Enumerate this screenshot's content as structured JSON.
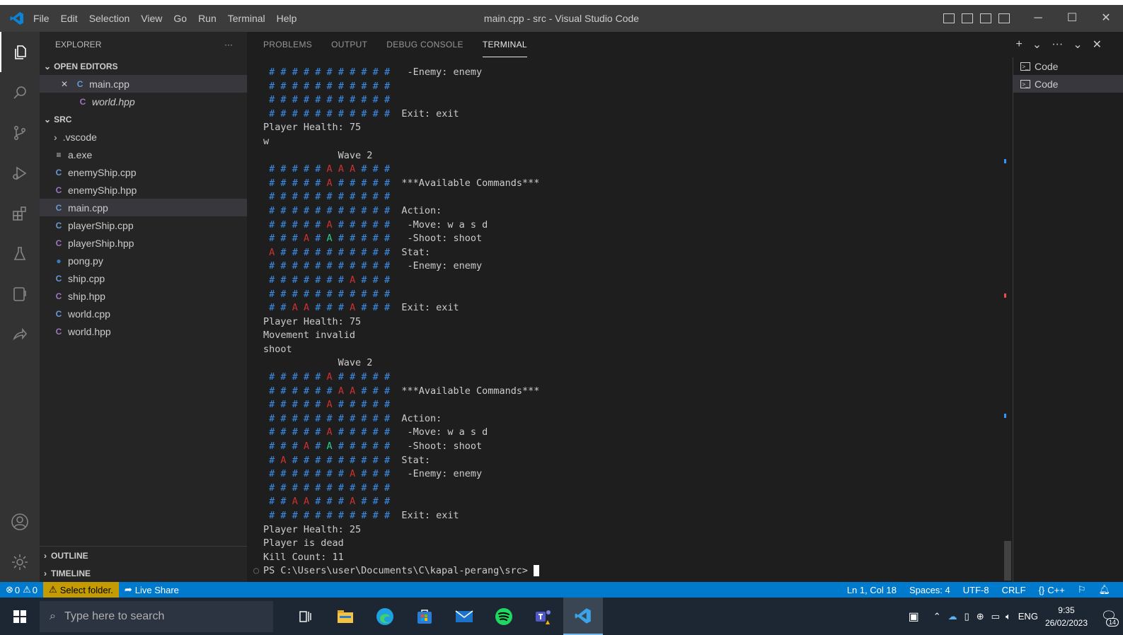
{
  "window": {
    "title": "main.cpp - src - Visual Studio Code",
    "menu": [
      "File",
      "Edit",
      "Selection",
      "View",
      "Go",
      "Run",
      "Terminal",
      "Help"
    ],
    "controls": {
      "minimize": "─",
      "maximize": "☐",
      "close": "✕"
    }
  },
  "activity_bar": [
    "explorer-icon",
    "search-icon",
    "source-control-icon",
    "run-debug-icon",
    "extensions-icon",
    "testing-icon",
    "remote-explorer-icon",
    "live-share-icon"
  ],
  "activity_bottom": [
    "account-icon",
    "settings-gear-icon"
  ],
  "sidebar": {
    "header": "EXPLORER",
    "header_more": "···",
    "open_editors": {
      "title": "OPEN EDITORS",
      "items": [
        {
          "close": "✕",
          "icon": "C",
          "name": "main.cpp"
        },
        {
          "icon": "C",
          "name": "world.hpp"
        }
      ]
    },
    "src": {
      "title": "SRC",
      "folder": ".vscode",
      "files": [
        "a.exe",
        "enemyShip.cpp",
        "enemyShip.hpp",
        "main.cpp",
        "playerShip.cpp",
        "playerShip.hpp",
        "pong.py",
        "ship.cpp",
        "ship.hpp",
        "world.cpp",
        "world.hpp"
      ]
    },
    "outline": "OUTLINE",
    "timeline": "TIMELINE"
  },
  "panel": {
    "tabs": [
      "PROBLEMS",
      "OUTPUT",
      "DEBUG CONSOLE",
      "TERMINAL"
    ],
    "active_tab": "TERMINAL",
    "actions": [
      "+",
      "⌄",
      "···",
      "⌄",
      "✕"
    ],
    "terminals": [
      "Code",
      "Code"
    ]
  },
  "terminal": {
    "lines": [
      " # # # # # # # # # # #   -Enemy: enemy",
      " # # # # # # # # # # #",
      " # # # # # # # # # # #",
      " # # # # # # # # # # #  Exit: exit",
      "Player Health: 75",
      "w",
      "             Wave 2",
      " # # # # # A A A # # #",
      " # # # # # A # # # # #  ***Available Commands***",
      " # # # # # # # # # # #",
      " # # # # # # # # # # #  Action:",
      " # # # # # A # # # # #   -Move: w a s d",
      " # # # A # A # # # # #   -Shoot: shoot",
      " A # # # # # # # # # #  Stat:",
      " # # # # # # # # # # #   -Enemy: enemy",
      " # # # # # # # A # # #",
      " # # # # # # # # # # #",
      " # # A A # # # A # # #  Exit: exit",
      "Player Health: 75",
      "Movement invalid",
      "shoot",
      "             Wave 2",
      " # # # # # A # # # # #",
      " # # # # # # A A # # #  ***Available Commands***",
      " # # # # # A # # # # #",
      " # # # # # # # # # # #  Action:",
      " # # # # # A # # # # #   -Move: w a s d",
      " # # # A # A # # # # #   -Shoot: shoot",
      " # A # # # # # # # # #  Stat:",
      " # # # # # # # A # # #   -Enemy: enemy",
      " # # # # # # # # # # #",
      " # # A A # # # A # # #",
      " # # # # # # # # # # #  Exit: exit",
      "Player Health: 25",
      "Player is dead",
      "Kill Count: 11",
      "PS C:\\Users\\user\\Documents\\C\\kapal-perang\\src> "
    ],
    "green_cells": [
      [
        12,
        5
      ],
      [
        27,
        5
      ]
    ]
  },
  "statusbar": {
    "errors": "0",
    "warnings": "0",
    "select_folder": "Select folder.",
    "live_share": "Live Share",
    "position": "Ln 1, Col 18",
    "spaces": "Spaces: 4",
    "encoding": "UTF-8",
    "eol": "CRLF",
    "language": "C++"
  },
  "taskbar": {
    "search_placeholder": "Type here to search",
    "apps": [
      "task-view-icon",
      "file-explorer-icon",
      "edge-icon",
      "store-icon",
      "mail-icon",
      "spotify-icon",
      "teams-icon",
      "vscode-icon"
    ],
    "tray_lang": "ENG",
    "time": "9:35",
    "date": "26/02/2023",
    "notifications": "14"
  },
  "colors": {
    "accent": "#007acc",
    "hash": "#3b8eea",
    "enemy": "#cd3131",
    "player": "#23d18b"
  }
}
